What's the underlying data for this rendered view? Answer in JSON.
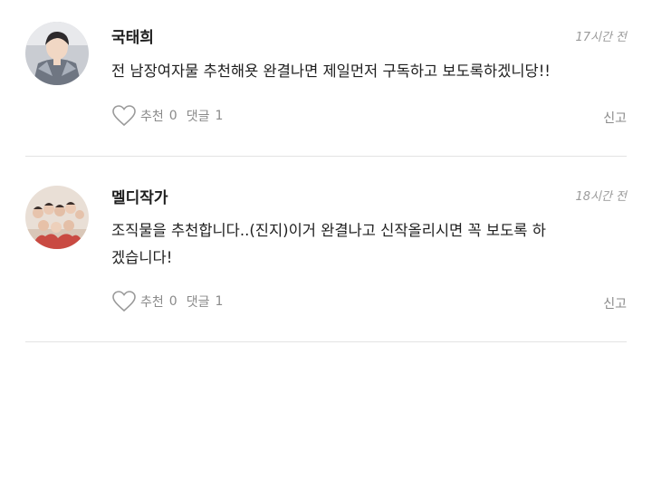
{
  "comments": [
    {
      "author": "국태희",
      "time": "17시간 전",
      "text": "전 남장여자물 추천해욧 완결나면 제일먼저 구독하고 보도록하겠니당!!",
      "like_label": "추천",
      "like_count": "0",
      "reply_label": "댓글",
      "reply_count": "1",
      "report_label": "신고"
    },
    {
      "author": "멜디작가",
      "time": "18시간 전",
      "text": "조직물을 추천합니다..(진지)이거 완결나고 신작올리시면 꼭 보도록 하겠습니다!",
      "like_label": "추천",
      "like_count": "0",
      "reply_label": "댓글",
      "reply_count": "1",
      "report_label": "신고"
    }
  ]
}
